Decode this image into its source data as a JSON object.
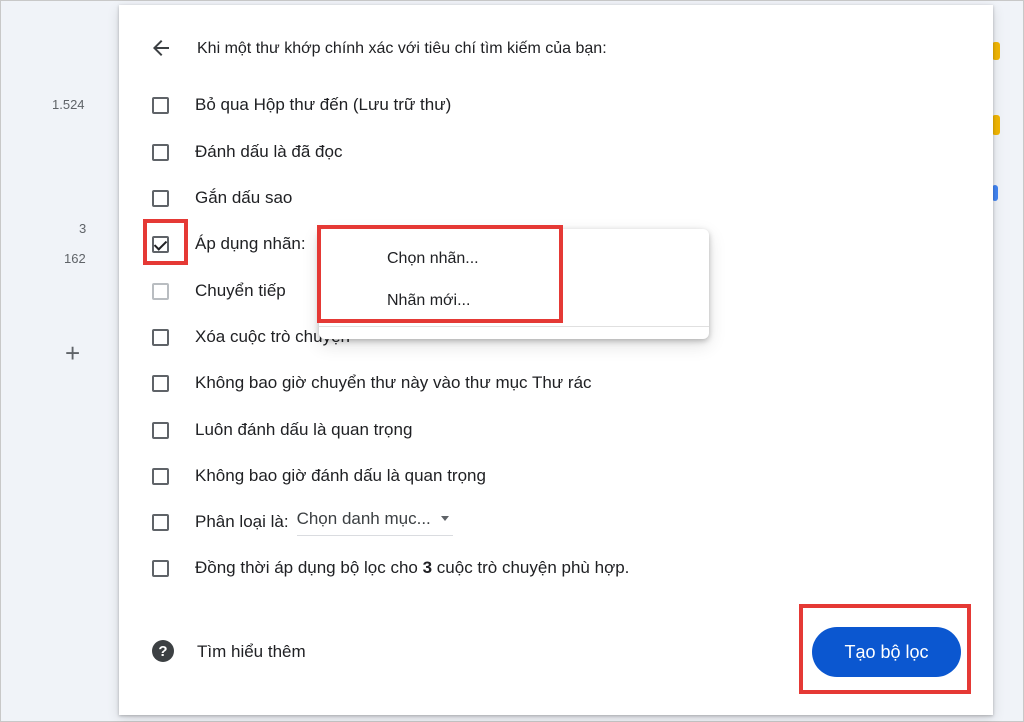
{
  "background": {
    "counts": [
      "1.524",
      "3",
      "162"
    ],
    "add_symbol": "+"
  },
  "dialog": {
    "header": "Khi một thư khớp chính xác với tiêu chí tìm kiếm của bạn:",
    "options": [
      {
        "label": "Bỏ qua Hộp thư đến (Lưu trữ thư)",
        "checked": false
      },
      {
        "label": "Đánh dấu là đã đọc",
        "checked": false
      },
      {
        "label": "Gắn dấu sao",
        "checked": false
      },
      {
        "label": "Áp dụng nhãn:",
        "checked": true
      },
      {
        "label": "Chuyển tiếp",
        "checked": false
      },
      {
        "label": "Xóa cuộc trò chuyện",
        "checked": false
      },
      {
        "label": "Không bao giờ chuyển thư này vào thư mục Thư rác",
        "checked": false
      },
      {
        "label": "Luôn đánh dấu là quan trọng",
        "checked": false
      },
      {
        "label": "Không bao giờ đánh dấu là quan trọng",
        "checked": false
      },
      {
        "label": "Phân loại là:",
        "checked": false
      },
      {
        "label_prefix": "Đồng thời áp dụng bộ lọc cho ",
        "count": "3",
        "label_suffix": " cuộc trò chuyện phù hợp.",
        "checked": false
      }
    ],
    "category_select": "Chọn danh mục...",
    "label_menu": [
      "Chọn nhãn...",
      "Nhãn mới..."
    ],
    "learn_more": "Tìm hiểu thêm",
    "create_button": "Tạo bộ lọc",
    "accent_color": "#0b57d0",
    "highlight_color": "#e53935"
  }
}
